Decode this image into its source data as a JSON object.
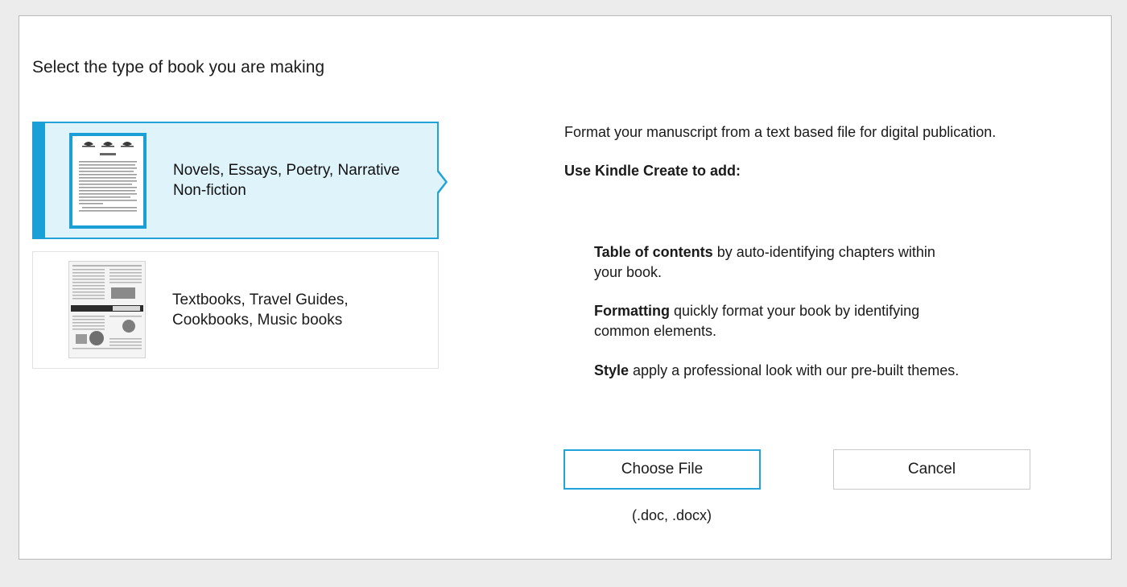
{
  "dialog": {
    "title": "Select the type of book you are making"
  },
  "options": [
    {
      "label_line1": "Novels, Essays, Poetry, Narrative",
      "label_line2": "Non-fiction",
      "selected": true,
      "thumbnail": "novel-page-thumbnail"
    },
    {
      "label_line1": "Textbooks, Travel Guides,",
      "label_line2": "Cookbooks, Music books",
      "selected": false,
      "thumbnail": "textbook-page-thumbnail"
    }
  ],
  "details": {
    "description": "Format your manuscript from a text based file for digital publication.",
    "subhead": "Use Kindle Create to add:",
    "features": [
      {
        "term": "Table of contents",
        "text_line1": " by auto-identifying chapters within",
        "text_line2": "your book."
      },
      {
        "term": "Formatting",
        "text_line1": " quickly format your book by identifying",
        "text_line2": "common elements."
      },
      {
        "term": "Style",
        "text_line1": " apply a professional look with our pre-built themes.",
        "text_line2": ""
      }
    ]
  },
  "actions": {
    "choose_file": "Choose File",
    "cancel": "Cancel",
    "file_types": "(.doc, .docx)"
  },
  "colors": {
    "accent": "#1b9fd7",
    "selected_bg": "#dff3fb",
    "border": "#20a3d8"
  }
}
